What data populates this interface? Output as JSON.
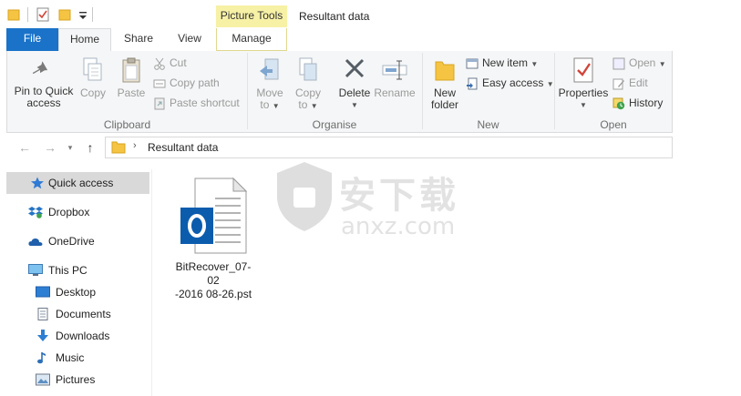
{
  "window": {
    "title": "Resultant data",
    "contextual_tab_group": "Picture Tools"
  },
  "tabs": {
    "file": "File",
    "home": "Home",
    "share": "Share",
    "view": "View",
    "manage": "Manage"
  },
  "ribbon": {
    "clipboard": {
      "label": "Clipboard",
      "pin_line1": "Pin to Quick",
      "pin_line2": "access",
      "copy": "Copy",
      "paste": "Paste",
      "cut": "Cut",
      "copy_path": "Copy path",
      "paste_shortcut": "Paste shortcut"
    },
    "organise": {
      "label": "Organise",
      "move_line1": "Move",
      "move_line2": "to",
      "copy_line1": "Copy",
      "copy_line2": "to",
      "delete": "Delete",
      "rename": "Rename"
    },
    "new": {
      "label": "New",
      "new_folder_line1": "New",
      "new_folder_line2": "folder",
      "new_item": "New item",
      "easy_access": "Easy access"
    },
    "open": {
      "label": "Open",
      "properties": "Properties",
      "open": "Open",
      "edit": "Edit",
      "history": "History"
    }
  },
  "address": {
    "path": "Resultant data"
  },
  "nav_pane": {
    "items": [
      {
        "label": "Quick access",
        "icon": "star-icon"
      },
      {
        "label": "Dropbox",
        "icon": "dropbox-icon"
      },
      {
        "label": "OneDrive",
        "icon": "cloud-icon"
      },
      {
        "label": "This PC",
        "icon": "computer-icon"
      },
      {
        "label": "Desktop",
        "icon": "desktop-icon"
      },
      {
        "label": "Documents",
        "icon": "documents-icon"
      },
      {
        "label": "Downloads",
        "icon": "download-icon"
      },
      {
        "label": "Music",
        "icon": "music-icon"
      },
      {
        "label": "Pictures",
        "icon": "pictures-icon"
      }
    ]
  },
  "files": [
    {
      "name_line1": "BitRecover_07-02",
      "name_line2": "-2016 08-26.pst",
      "icon": "outlook-pst-icon"
    }
  ],
  "watermark": {
    "chinese": "安下载",
    "domain": "anxz.com"
  },
  "colors": {
    "file_tab": "#1a73c9",
    "contextual": "#f7f1a6",
    "selected_nav": "#d9d9d9",
    "outlook_blue": "#0b5cad"
  }
}
